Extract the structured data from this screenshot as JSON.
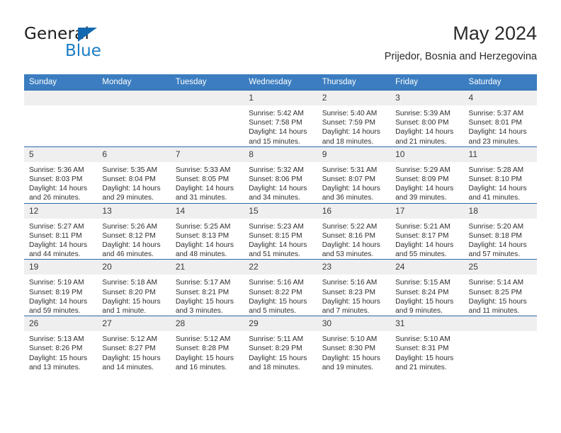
{
  "logo": {
    "word_top": "General",
    "word_bottom": "Blue",
    "triangle_color": "#1269b0",
    "blue_color": "#1a7cc4"
  },
  "header": {
    "title": "May 2024",
    "subtitle": "Prijedor, Bosnia and Herzegovina"
  },
  "theme": {
    "header_bg": "#3b7dc0",
    "row_border": "#2c6aa8",
    "daynum_bg": "#efefef"
  },
  "weekdays": [
    "Sunday",
    "Monday",
    "Tuesday",
    "Wednesday",
    "Thursday",
    "Friday",
    "Saturday"
  ],
  "labels": {
    "sunrise": "Sunrise:",
    "sunset": "Sunset:",
    "daylight": "Daylight:"
  },
  "weeks": [
    [
      {
        "day": "",
        "empty": true
      },
      {
        "day": "",
        "empty": true
      },
      {
        "day": "",
        "empty": true
      },
      {
        "day": "1",
        "sunrise": "Sunrise: 5:42 AM",
        "sunset": "Sunset: 7:58 PM",
        "daylight": "Daylight: 14 hours and 15 minutes."
      },
      {
        "day": "2",
        "sunrise": "Sunrise: 5:40 AM",
        "sunset": "Sunset: 7:59 PM",
        "daylight": "Daylight: 14 hours and 18 minutes."
      },
      {
        "day": "3",
        "sunrise": "Sunrise: 5:39 AM",
        "sunset": "Sunset: 8:00 PM",
        "daylight": "Daylight: 14 hours and 21 minutes."
      },
      {
        "day": "4",
        "sunrise": "Sunrise: 5:37 AM",
        "sunset": "Sunset: 8:01 PM",
        "daylight": "Daylight: 14 hours and 23 minutes."
      }
    ],
    [
      {
        "day": "5",
        "sunrise": "Sunrise: 5:36 AM",
        "sunset": "Sunset: 8:03 PM",
        "daylight": "Daylight: 14 hours and 26 minutes."
      },
      {
        "day": "6",
        "sunrise": "Sunrise: 5:35 AM",
        "sunset": "Sunset: 8:04 PM",
        "daylight": "Daylight: 14 hours and 29 minutes."
      },
      {
        "day": "7",
        "sunrise": "Sunrise: 5:33 AM",
        "sunset": "Sunset: 8:05 PM",
        "daylight": "Daylight: 14 hours and 31 minutes."
      },
      {
        "day": "8",
        "sunrise": "Sunrise: 5:32 AM",
        "sunset": "Sunset: 8:06 PM",
        "daylight": "Daylight: 14 hours and 34 minutes."
      },
      {
        "day": "9",
        "sunrise": "Sunrise: 5:31 AM",
        "sunset": "Sunset: 8:07 PM",
        "daylight": "Daylight: 14 hours and 36 minutes."
      },
      {
        "day": "10",
        "sunrise": "Sunrise: 5:29 AM",
        "sunset": "Sunset: 8:09 PM",
        "daylight": "Daylight: 14 hours and 39 minutes."
      },
      {
        "day": "11",
        "sunrise": "Sunrise: 5:28 AM",
        "sunset": "Sunset: 8:10 PM",
        "daylight": "Daylight: 14 hours and 41 minutes."
      }
    ],
    [
      {
        "day": "12",
        "sunrise": "Sunrise: 5:27 AM",
        "sunset": "Sunset: 8:11 PM",
        "daylight": "Daylight: 14 hours and 44 minutes."
      },
      {
        "day": "13",
        "sunrise": "Sunrise: 5:26 AM",
        "sunset": "Sunset: 8:12 PM",
        "daylight": "Daylight: 14 hours and 46 minutes."
      },
      {
        "day": "14",
        "sunrise": "Sunrise: 5:25 AM",
        "sunset": "Sunset: 8:13 PM",
        "daylight": "Daylight: 14 hours and 48 minutes."
      },
      {
        "day": "15",
        "sunrise": "Sunrise: 5:23 AM",
        "sunset": "Sunset: 8:15 PM",
        "daylight": "Daylight: 14 hours and 51 minutes."
      },
      {
        "day": "16",
        "sunrise": "Sunrise: 5:22 AM",
        "sunset": "Sunset: 8:16 PM",
        "daylight": "Daylight: 14 hours and 53 minutes."
      },
      {
        "day": "17",
        "sunrise": "Sunrise: 5:21 AM",
        "sunset": "Sunset: 8:17 PM",
        "daylight": "Daylight: 14 hours and 55 minutes."
      },
      {
        "day": "18",
        "sunrise": "Sunrise: 5:20 AM",
        "sunset": "Sunset: 8:18 PM",
        "daylight": "Daylight: 14 hours and 57 minutes."
      }
    ],
    [
      {
        "day": "19",
        "sunrise": "Sunrise: 5:19 AM",
        "sunset": "Sunset: 8:19 PM",
        "daylight": "Daylight: 14 hours and 59 minutes."
      },
      {
        "day": "20",
        "sunrise": "Sunrise: 5:18 AM",
        "sunset": "Sunset: 8:20 PM",
        "daylight": "Daylight: 15 hours and 1 minute."
      },
      {
        "day": "21",
        "sunrise": "Sunrise: 5:17 AM",
        "sunset": "Sunset: 8:21 PM",
        "daylight": "Daylight: 15 hours and 3 minutes."
      },
      {
        "day": "22",
        "sunrise": "Sunrise: 5:16 AM",
        "sunset": "Sunset: 8:22 PM",
        "daylight": "Daylight: 15 hours and 5 minutes."
      },
      {
        "day": "23",
        "sunrise": "Sunrise: 5:16 AM",
        "sunset": "Sunset: 8:23 PM",
        "daylight": "Daylight: 15 hours and 7 minutes."
      },
      {
        "day": "24",
        "sunrise": "Sunrise: 5:15 AM",
        "sunset": "Sunset: 8:24 PM",
        "daylight": "Daylight: 15 hours and 9 minutes."
      },
      {
        "day": "25",
        "sunrise": "Sunrise: 5:14 AM",
        "sunset": "Sunset: 8:25 PM",
        "daylight": "Daylight: 15 hours and 11 minutes."
      }
    ],
    [
      {
        "day": "26",
        "sunrise": "Sunrise: 5:13 AM",
        "sunset": "Sunset: 8:26 PM",
        "daylight": "Daylight: 15 hours and 13 minutes."
      },
      {
        "day": "27",
        "sunrise": "Sunrise: 5:12 AM",
        "sunset": "Sunset: 8:27 PM",
        "daylight": "Daylight: 15 hours and 14 minutes."
      },
      {
        "day": "28",
        "sunrise": "Sunrise: 5:12 AM",
        "sunset": "Sunset: 8:28 PM",
        "daylight": "Daylight: 15 hours and 16 minutes."
      },
      {
        "day": "29",
        "sunrise": "Sunrise: 5:11 AM",
        "sunset": "Sunset: 8:29 PM",
        "daylight": "Daylight: 15 hours and 18 minutes."
      },
      {
        "day": "30",
        "sunrise": "Sunrise: 5:10 AM",
        "sunset": "Sunset: 8:30 PM",
        "daylight": "Daylight: 15 hours and 19 minutes."
      },
      {
        "day": "31",
        "sunrise": "Sunrise: 5:10 AM",
        "sunset": "Sunset: 8:31 PM",
        "daylight": "Daylight: 15 hours and 21 minutes."
      },
      {
        "day": "",
        "empty": true
      }
    ]
  ]
}
